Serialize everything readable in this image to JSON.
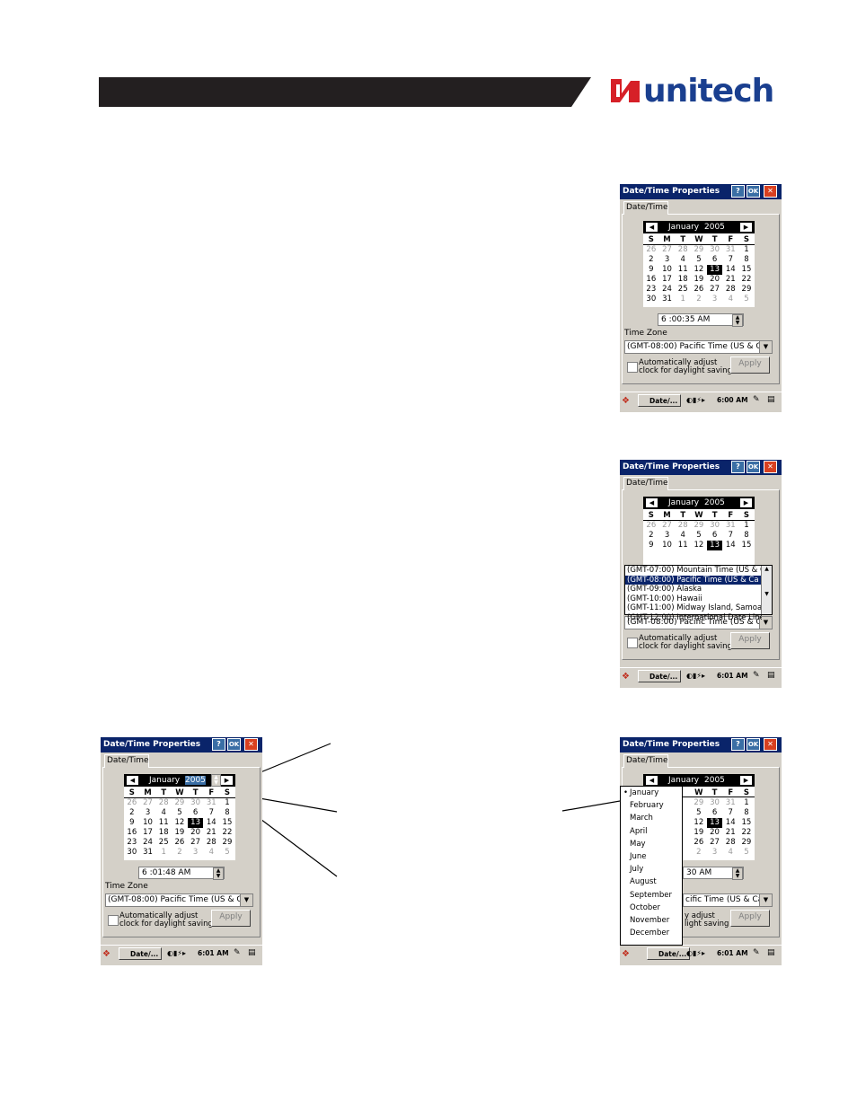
{
  "brand": {
    "name": "unitech",
    "accent": "#1a3f8f",
    "mark_color": "#d62027"
  },
  "windows": [
    {
      "title": "Date/Time Properties",
      "help": "?",
      "ok": "OK",
      "close": "✕",
      "tab": "Date/Time",
      "month": "January",
      "year": "2005",
      "weekdays": [
        "S",
        "M",
        "T",
        "W",
        "T",
        "F",
        "S"
      ],
      "weeks": [
        [
          "26",
          "27",
          "28",
          "29",
          "30",
          "31",
          "1"
        ],
        [
          "2",
          "3",
          "4",
          "5",
          "6",
          "7",
          "8"
        ],
        [
          "9",
          "10",
          "11",
          "12",
          "13",
          "14",
          "15"
        ],
        [
          "16",
          "17",
          "18",
          "19",
          "20",
          "21",
          "22"
        ],
        [
          "23",
          "24",
          "25",
          "26",
          "27",
          "28",
          "29"
        ],
        [
          "30",
          "31",
          "1",
          "2",
          "3",
          "4",
          "5"
        ]
      ],
      "time": "6 :00:35 AM",
      "tz_label": "Time Zone",
      "tz_value": "(GMT-08:00) Pacific Time (US & Ca",
      "auto_line1": "Automatically adjust",
      "auto_line2": "clock for daylight saving",
      "apply": "Apply",
      "task_button": "Date/...",
      "tray_time": "6:00 AM"
    },
    {
      "title": "Date/Time Properties",
      "help": "?",
      "ok": "OK",
      "close": "✕",
      "tab": "Date/Time",
      "month": "January",
      "year": "2005",
      "weekdays": [
        "S",
        "M",
        "T",
        "W",
        "T",
        "F",
        "S"
      ],
      "weeks": [
        [
          "26",
          "27",
          "28",
          "29",
          "30",
          "31",
          "1"
        ],
        [
          "2",
          "3",
          "4",
          "5",
          "6",
          "7",
          "8"
        ],
        [
          "9",
          "10",
          "11",
          "12",
          "13",
          "14",
          "15"
        ]
      ],
      "tz_options": [
        "(GMT-07:00) Mountain Time (US & C",
        "(GMT-08:00) Pacific Time (US & Ca",
        "(GMT-09:00) Alaska",
        "(GMT-10:00) Hawaii",
        "(GMT-11:00) Midway Island, Samoa",
        "(GMT-12:00) International Date Line"
      ],
      "tz_value": "(GMT-08:00) Pacific Time (US & Ca",
      "auto_line1": "Automatically adjust",
      "auto_line2": "clock for daylight saving",
      "apply": "Apply",
      "task_button": "Date/...",
      "tray_time": "6:01 AM"
    },
    {
      "title": "Date/Time Properties",
      "help": "?",
      "ok": "OK",
      "close": "✕",
      "tab": "Date/Time",
      "month": "January",
      "year": "2005",
      "weekdays": [
        "S",
        "M",
        "T",
        "W",
        "T",
        "F",
        "S"
      ],
      "weeks": [
        [
          "26",
          "27",
          "28",
          "29",
          "30",
          "31",
          "1"
        ],
        [
          "2",
          "3",
          "4",
          "5",
          "6",
          "7",
          "8"
        ],
        [
          "9",
          "10",
          "11",
          "12",
          "13",
          "14",
          "15"
        ],
        [
          "16",
          "17",
          "18",
          "19",
          "20",
          "21",
          "22"
        ],
        [
          "23",
          "24",
          "25",
          "26",
          "27",
          "28",
          "29"
        ],
        [
          "30",
          "31",
          "1",
          "2",
          "3",
          "4",
          "5"
        ]
      ],
      "time": "6 :01:48 AM",
      "tz_label": "Time Zone",
      "tz_value": "(GMT-08:00) Pacific Time (US & Ca",
      "auto_line1": "Automatically adjust",
      "auto_line2": "clock for daylight saving",
      "apply": "Apply",
      "task_button": "Date/...",
      "tray_time": "6:01 AM"
    },
    {
      "title": "Date/Time Properties",
      "help": "?",
      "ok": "OK",
      "close": "✕",
      "tab": "Date/Time",
      "month": "January",
      "year": "2005",
      "weekdays": [
        "W",
        "T",
        "F",
        "S"
      ],
      "weeks": [
        [
          "29",
          "30",
          "31",
          "1"
        ],
        [
          "5",
          "6",
          "7",
          "8"
        ],
        [
          "12",
          "13",
          "14",
          "15"
        ],
        [
          "19",
          "20",
          "21",
          "22"
        ],
        [
          "26",
          "27",
          "28",
          "29"
        ],
        [
          "2",
          "3",
          "4",
          "5"
        ]
      ],
      "months": [
        "January",
        "February",
        "March",
        "April",
        "May",
        "June",
        "July",
        "August",
        "September",
        "October",
        "November",
        "December"
      ],
      "time_partial": "30 AM",
      "tz_partial": "cific Time (US & Ca",
      "auto_partial1": "y adjust",
      "auto_partial2": "light saving",
      "apply": "Apply",
      "task_button": "Date/...",
      "tray_time": "6:01 AM"
    }
  ]
}
